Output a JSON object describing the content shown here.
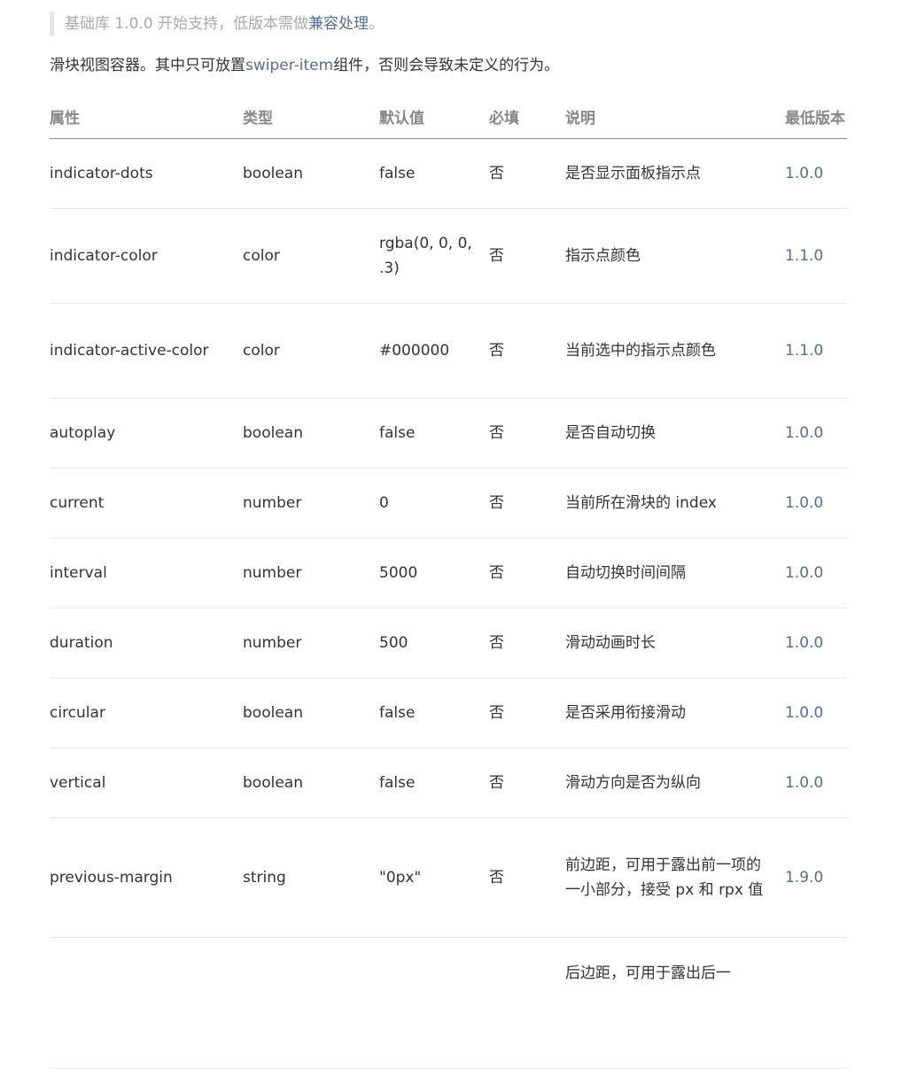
{
  "note": {
    "prefix": "基础库 1.0.0 开始支持，低版本需做",
    "link": "兼容处理",
    "suffix": "。"
  },
  "intro": {
    "prefix": "滑块视图容器。其中只可放置",
    "link": "swiper-item",
    "suffix": "组件，否则会导致未定义的行为。"
  },
  "table": {
    "headers": {
      "attr": "属性",
      "type": "类型",
      "default": "默认值",
      "required": "必填",
      "desc": "说明",
      "version": "最低版本"
    },
    "rows": [
      {
        "attr": "indicator-dots",
        "type": "boolean",
        "default": "false",
        "required": "否",
        "desc": "是否显示面板指示点",
        "version": "1.0.0"
      },
      {
        "attr": "indicator-color",
        "type": "color",
        "default": "rgba(0, 0, 0, .3)",
        "required": "否",
        "desc": "指示点颜色",
        "version": "1.1.0"
      },
      {
        "attr": "indicator-active-color",
        "type": "color",
        "default": "#000000",
        "required": "否",
        "desc": "当前选中的指示点颜色",
        "version": "1.1.0"
      },
      {
        "attr": "autoplay",
        "type": "boolean",
        "default": "false",
        "required": "否",
        "desc": "是否自动切换",
        "version": "1.0.0"
      },
      {
        "attr": "current",
        "type": "number",
        "default": "0",
        "required": "否",
        "desc": "当前所在滑块的 index",
        "version": "1.0.0"
      },
      {
        "attr": "interval",
        "type": "number",
        "default": "5000",
        "required": "否",
        "desc": "自动切换时间间隔",
        "version": "1.0.0"
      },
      {
        "attr": "duration",
        "type": "number",
        "default": "500",
        "required": "否",
        "desc": "滑动动画时长",
        "version": "1.0.0"
      },
      {
        "attr": "circular",
        "type": "boolean",
        "default": "false",
        "required": "否",
        "desc": "是否采用衔接滑动",
        "version": "1.0.0"
      },
      {
        "attr": "vertical",
        "type": "boolean",
        "default": "false",
        "required": "否",
        "desc": "滑动方向是否为纵向",
        "version": "1.0.0"
      },
      {
        "attr": "previous-margin",
        "type": "string",
        "default": "\"0px\"",
        "required": "否",
        "desc": "前边距，可用于露出前一项的一小部分，接受 px 和 rpx 值",
        "version": "1.9.0"
      },
      {
        "attr": "",
        "type": "",
        "default": "",
        "required": "",
        "desc": "后边距，可用于露出后一",
        "version": ""
      }
    ]
  },
  "colors": {
    "link": "#576b95",
    "header_text": "#888888",
    "note_text": "#aaaaaa",
    "body_text": "#333333"
  }
}
